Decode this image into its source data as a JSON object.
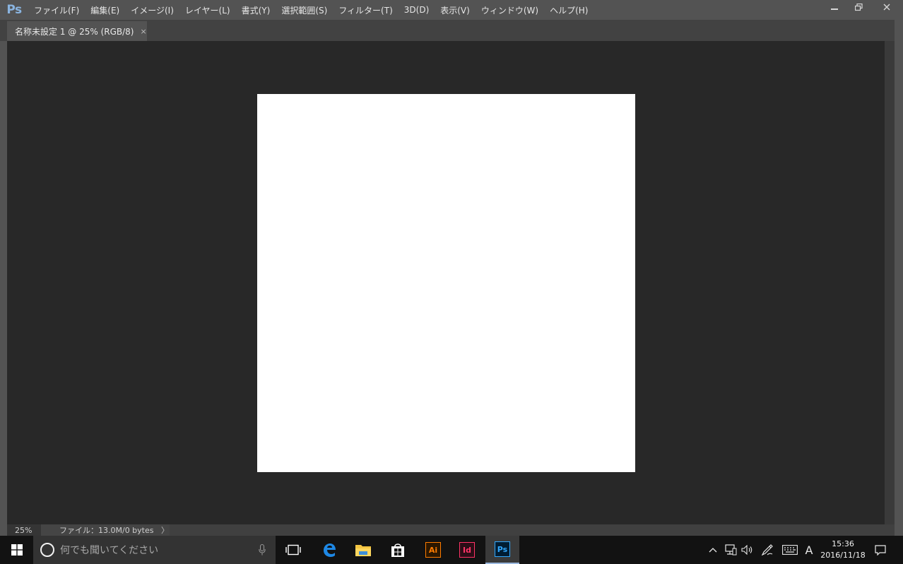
{
  "app": {
    "logo": "Ps",
    "colors": {
      "chrome": "#535353",
      "canvas_bg": "#282828",
      "document": "#ffffff",
      "logo": "#8ab4e0"
    }
  },
  "menu": [
    {
      "label": "ファイル(F)"
    },
    {
      "label": "編集(E)"
    },
    {
      "label": "イメージ(I)"
    },
    {
      "label": "レイヤー(L)"
    },
    {
      "label": "書式(Y)"
    },
    {
      "label": "選択範囲(S)"
    },
    {
      "label": "フィルター(T)"
    },
    {
      "label": "3D(D)"
    },
    {
      "label": "表示(V)"
    },
    {
      "label": "ウィンドウ(W)"
    },
    {
      "label": "ヘルプ(H)"
    }
  ],
  "window_controls": {
    "minimize": "minimize-icon",
    "restore": "restore-icon",
    "close": "close-icon"
  },
  "document_tab": {
    "title": "名称未設定 1 @ 25% (RGB/8)",
    "close_glyph": "×"
  },
  "status": {
    "zoom": "25%",
    "file_info": "ファイル：13.0M/0 bytes",
    "arrow": "〉"
  },
  "taskbar": {
    "search_placeholder": "何でも聞いてください",
    "apps": [
      {
        "name": "task-view-icon"
      },
      {
        "name": "edge-icon"
      },
      {
        "name": "file-explorer-icon"
      },
      {
        "name": "store-icon"
      },
      {
        "name": "illustrator-icon",
        "label": "Ai",
        "color": "#ff7c00"
      },
      {
        "name": "indesign-icon",
        "label": "Id",
        "color": "#ff3366"
      },
      {
        "name": "photoshop-icon",
        "label": "Ps",
        "color": "#31a8ff"
      }
    ],
    "ime": "A",
    "time": "15:36",
    "date": "2016/11/18"
  }
}
